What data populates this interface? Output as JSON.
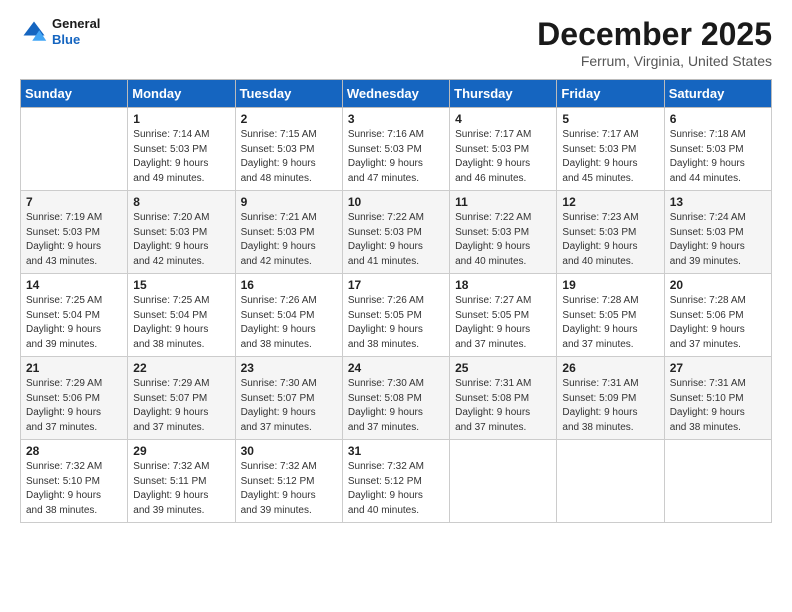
{
  "header": {
    "logo_line1": "General",
    "logo_line2": "Blue",
    "title": "December 2025",
    "subtitle": "Ferrum, Virginia, United States"
  },
  "days_of_week": [
    "Sunday",
    "Monday",
    "Tuesday",
    "Wednesday",
    "Thursday",
    "Friday",
    "Saturday"
  ],
  "weeks": [
    [
      {
        "day": "",
        "info": ""
      },
      {
        "day": "1",
        "info": "Sunrise: 7:14 AM\nSunset: 5:03 PM\nDaylight: 9 hours\nand 49 minutes."
      },
      {
        "day": "2",
        "info": "Sunrise: 7:15 AM\nSunset: 5:03 PM\nDaylight: 9 hours\nand 48 minutes."
      },
      {
        "day": "3",
        "info": "Sunrise: 7:16 AM\nSunset: 5:03 PM\nDaylight: 9 hours\nand 47 minutes."
      },
      {
        "day": "4",
        "info": "Sunrise: 7:17 AM\nSunset: 5:03 PM\nDaylight: 9 hours\nand 46 minutes."
      },
      {
        "day": "5",
        "info": "Sunrise: 7:17 AM\nSunset: 5:03 PM\nDaylight: 9 hours\nand 45 minutes."
      },
      {
        "day": "6",
        "info": "Sunrise: 7:18 AM\nSunset: 5:03 PM\nDaylight: 9 hours\nand 44 minutes."
      }
    ],
    [
      {
        "day": "7",
        "info": "Sunrise: 7:19 AM\nSunset: 5:03 PM\nDaylight: 9 hours\nand 43 minutes."
      },
      {
        "day": "8",
        "info": "Sunrise: 7:20 AM\nSunset: 5:03 PM\nDaylight: 9 hours\nand 42 minutes."
      },
      {
        "day": "9",
        "info": "Sunrise: 7:21 AM\nSunset: 5:03 PM\nDaylight: 9 hours\nand 42 minutes."
      },
      {
        "day": "10",
        "info": "Sunrise: 7:22 AM\nSunset: 5:03 PM\nDaylight: 9 hours\nand 41 minutes."
      },
      {
        "day": "11",
        "info": "Sunrise: 7:22 AM\nSunset: 5:03 PM\nDaylight: 9 hours\nand 40 minutes."
      },
      {
        "day": "12",
        "info": "Sunrise: 7:23 AM\nSunset: 5:03 PM\nDaylight: 9 hours\nand 40 minutes."
      },
      {
        "day": "13",
        "info": "Sunrise: 7:24 AM\nSunset: 5:03 PM\nDaylight: 9 hours\nand 39 minutes."
      }
    ],
    [
      {
        "day": "14",
        "info": "Sunrise: 7:25 AM\nSunset: 5:04 PM\nDaylight: 9 hours\nand 39 minutes."
      },
      {
        "day": "15",
        "info": "Sunrise: 7:25 AM\nSunset: 5:04 PM\nDaylight: 9 hours\nand 38 minutes."
      },
      {
        "day": "16",
        "info": "Sunrise: 7:26 AM\nSunset: 5:04 PM\nDaylight: 9 hours\nand 38 minutes."
      },
      {
        "day": "17",
        "info": "Sunrise: 7:26 AM\nSunset: 5:05 PM\nDaylight: 9 hours\nand 38 minutes."
      },
      {
        "day": "18",
        "info": "Sunrise: 7:27 AM\nSunset: 5:05 PM\nDaylight: 9 hours\nand 37 minutes."
      },
      {
        "day": "19",
        "info": "Sunrise: 7:28 AM\nSunset: 5:05 PM\nDaylight: 9 hours\nand 37 minutes."
      },
      {
        "day": "20",
        "info": "Sunrise: 7:28 AM\nSunset: 5:06 PM\nDaylight: 9 hours\nand 37 minutes."
      }
    ],
    [
      {
        "day": "21",
        "info": "Sunrise: 7:29 AM\nSunset: 5:06 PM\nDaylight: 9 hours\nand 37 minutes."
      },
      {
        "day": "22",
        "info": "Sunrise: 7:29 AM\nSunset: 5:07 PM\nDaylight: 9 hours\nand 37 minutes."
      },
      {
        "day": "23",
        "info": "Sunrise: 7:30 AM\nSunset: 5:07 PM\nDaylight: 9 hours\nand 37 minutes."
      },
      {
        "day": "24",
        "info": "Sunrise: 7:30 AM\nSunset: 5:08 PM\nDaylight: 9 hours\nand 37 minutes."
      },
      {
        "day": "25",
        "info": "Sunrise: 7:31 AM\nSunset: 5:08 PM\nDaylight: 9 hours\nand 37 minutes."
      },
      {
        "day": "26",
        "info": "Sunrise: 7:31 AM\nSunset: 5:09 PM\nDaylight: 9 hours\nand 38 minutes."
      },
      {
        "day": "27",
        "info": "Sunrise: 7:31 AM\nSunset: 5:10 PM\nDaylight: 9 hours\nand 38 minutes."
      }
    ],
    [
      {
        "day": "28",
        "info": "Sunrise: 7:32 AM\nSunset: 5:10 PM\nDaylight: 9 hours\nand 38 minutes."
      },
      {
        "day": "29",
        "info": "Sunrise: 7:32 AM\nSunset: 5:11 PM\nDaylight: 9 hours\nand 39 minutes."
      },
      {
        "day": "30",
        "info": "Sunrise: 7:32 AM\nSunset: 5:12 PM\nDaylight: 9 hours\nand 39 minutes."
      },
      {
        "day": "31",
        "info": "Sunrise: 7:32 AM\nSunset: 5:12 PM\nDaylight: 9 hours\nand 40 minutes."
      },
      {
        "day": "",
        "info": ""
      },
      {
        "day": "",
        "info": ""
      },
      {
        "day": "",
        "info": ""
      }
    ]
  ]
}
